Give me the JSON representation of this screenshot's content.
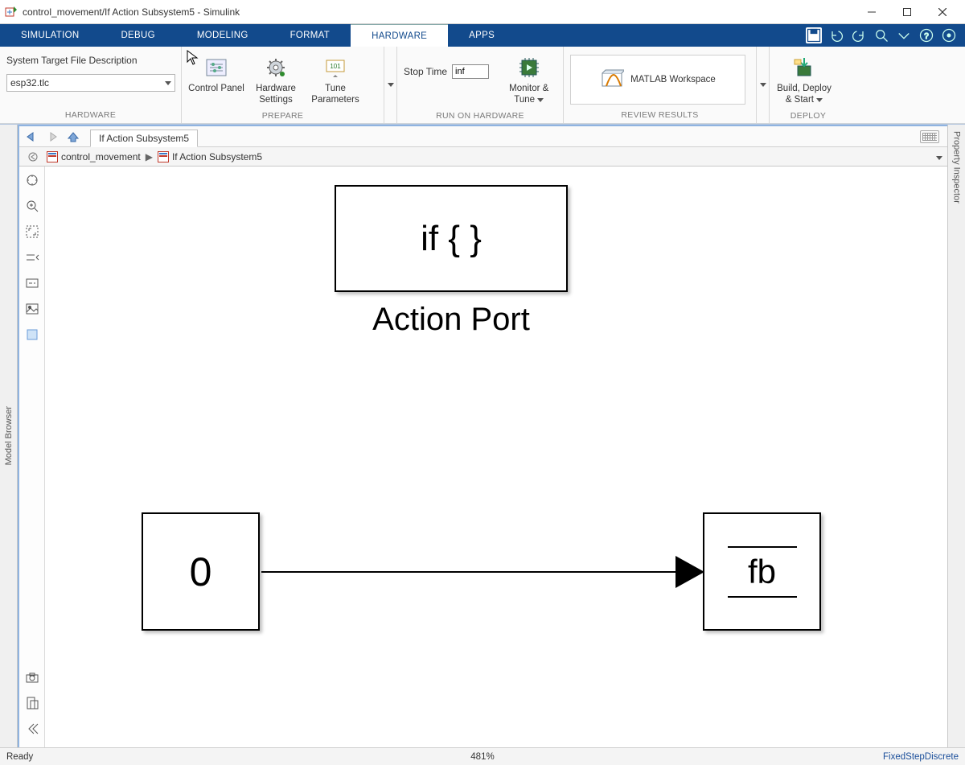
{
  "window": {
    "title": "control_movement/If Action Subsystem5 - Simulink"
  },
  "tabs": {
    "simulation": "SIMULATION",
    "debug": "DEBUG",
    "modeling": "MODELING",
    "format": "FORMAT",
    "hardware": "HARDWARE",
    "apps": "APPS"
  },
  "ribbon": {
    "hardware": {
      "label": "HARDWARE",
      "field_label": "System Target File Description",
      "combo_value": "esp32.tlc"
    },
    "prepare": {
      "label": "PREPARE",
      "control_panel": "Control Panel",
      "hardware_settings": "Hardware Settings",
      "tune_parameters": "Tune Parameters"
    },
    "run": {
      "label": "RUN ON HARDWARE",
      "stop_time_label": "Stop Time",
      "stop_time_value": "inf",
      "monitor_tune": "Monitor & Tune"
    },
    "review": {
      "label": "REVIEW RESULTS",
      "matlab_workspace": "MATLAB Workspace"
    },
    "deploy": {
      "label": "DEPLOY",
      "build_deploy": "Build, Deploy & Start"
    }
  },
  "sidebars": {
    "model_browser": "Model Browser",
    "property_inspector": "Property Inspector"
  },
  "nav": {
    "doc_tab": "If Action Subsystem5"
  },
  "breadcrumb": {
    "root": "control_movement",
    "leaf": "If Action Subsystem5"
  },
  "canvas": {
    "action_block": "if { }",
    "action_label": "Action Port",
    "const_block": "0",
    "out_block": "fb"
  },
  "status": {
    "ready": "Ready",
    "zoom": "481%",
    "solver": "FixedStepDiscrete"
  }
}
